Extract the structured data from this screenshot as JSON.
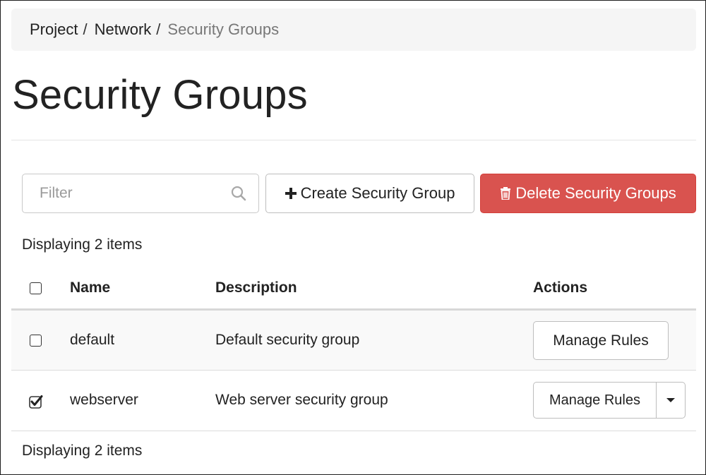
{
  "breadcrumb": {
    "items": [
      "Project",
      "Network",
      "Security Groups"
    ],
    "separator": "/"
  },
  "page": {
    "title": "Security Groups"
  },
  "toolbar": {
    "filter_placeholder": "Filter",
    "create_label": "Create Security Group",
    "delete_label": "Delete Security Groups",
    "delete_color": "#d9534f"
  },
  "table": {
    "count_label": "Displaying 2 items",
    "columns": [
      "Name",
      "Description",
      "Actions"
    ],
    "rows": [
      {
        "name": "default",
        "description": "Default security group",
        "action": "Manage Rules",
        "checked": false
      },
      {
        "name": "webserver",
        "description": "Web server security group",
        "action": "Manage Rules",
        "checked": true
      }
    ]
  },
  "icons": {
    "search": "search-icon",
    "create": "plus-icon",
    "delete": "trash-icon",
    "dropdown": "caret-down-icon",
    "checkbox": "checkbox-icon"
  }
}
